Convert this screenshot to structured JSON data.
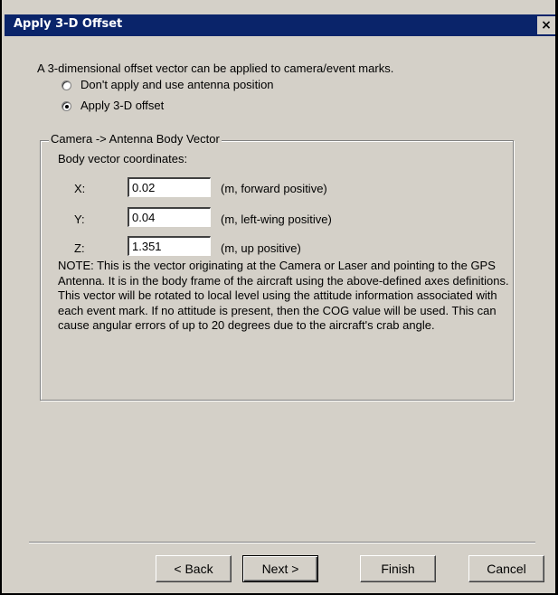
{
  "window": {
    "title": "Apply 3-D Offset",
    "close_glyph": "×"
  },
  "intro": "A 3-dimensional offset vector can be applied to camera/event marks.",
  "options": [
    {
      "label": "Don't apply and use antenna position",
      "selected": false
    },
    {
      "label": "Apply 3-D offset",
      "selected": true
    }
  ],
  "group": {
    "legend": "Camera -> Antenna Body Vector",
    "subtitle": "Body vector coordinates:",
    "rows": [
      {
        "axis": "X:",
        "value": "0.02",
        "unit": "(m, forward positive)"
      },
      {
        "axis": "Y:",
        "value": "0.04",
        "unit": "(m, left-wing positive)"
      },
      {
        "axis": "Z:",
        "value": "1.351",
        "unit": "(m, up positive)"
      }
    ],
    "note": "NOTE: This is the vector originating at the Camera or Laser and pointing to the GPS Antenna. It is in the body frame of the aircraft using the above-defined axes definitions. This vector will be rotated to local level using the attitude information associated with each event mark. If no attitude is present, then the COG value will be used.  This can cause angular  errors of up to 20 degrees due to the aircraft's crab angle."
  },
  "buttons": {
    "back": "< Back",
    "next": "Next >",
    "finish": "Finish",
    "cancel": "Cancel"
  }
}
